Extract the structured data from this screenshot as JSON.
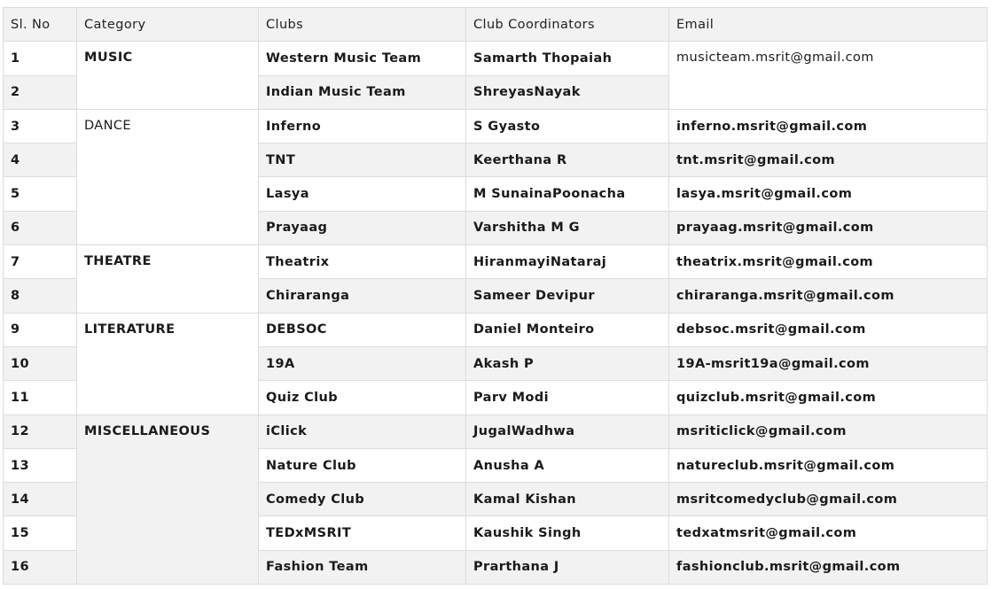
{
  "table": {
    "headers": {
      "sl_no": "Sl. No",
      "category": "Category",
      "clubs": "Clubs",
      "coordinators": "Club Coordinators",
      "email": "Email"
    },
    "categories": {
      "music": "MUSIC",
      "dance": "DANCE",
      "theatre": "THEATRE",
      "literature": "LITERATURE",
      "misc": "MISCELLANEOUS"
    },
    "rows": [
      {
        "no": "1",
        "club": "Western Music Team",
        "coordinator": "Samarth Thopaiah",
        "email": "musicteam.msrit@gmail.com"
      },
      {
        "no": "2",
        "club": "Indian Music Team",
        "coordinator": "ShreyasNayak",
        "email": ""
      },
      {
        "no": "3",
        "club": "Inferno",
        "coordinator": "S Gyasto",
        "email": "inferno.msrit@gmail.com"
      },
      {
        "no": "4",
        "club": "TNT",
        "coordinator": "Keerthana R",
        "email": "tnt.msrit@gmail.com"
      },
      {
        "no": "5",
        "club": "Lasya",
        "coordinator": "M SunainaPoonacha",
        "email": "lasya.msrit@gmail.com"
      },
      {
        "no": "6",
        "club": "Prayaag",
        "coordinator": "Varshitha M G",
        "email": "prayaag.msrit@gmail.com"
      },
      {
        "no": "7",
        "club": "Theatrix",
        "coordinator": "HiranmayiNataraj",
        "email": "theatrix.msrit@gmail.com"
      },
      {
        "no": "8",
        "club": "Chiraranga",
        "coordinator": "Sameer Devipur",
        "email": "chiraranga.msrit@gmail.com"
      },
      {
        "no": "9",
        "club": "DEBSOC",
        "coordinator": "Daniel Monteiro",
        "email": "debsoc.msrit@gmail.com"
      },
      {
        "no": "10",
        "club": "19A",
        "coordinator": "Akash P",
        "email": "19A-msrit19a@gmail.com"
      },
      {
        "no": "11",
        "club": "Quiz Club",
        "coordinator": "Parv Modi",
        "email": "quizclub.msrit@gmail.com"
      },
      {
        "no": "12",
        "club": "iClick",
        "coordinator": "JugalWadhwa",
        "email": "msriticlick@gmail.com"
      },
      {
        "no": "13",
        "club": "Nature Club",
        "coordinator": "Anusha A",
        "email": "natureclub.msrit@gmail.com"
      },
      {
        "no": "14",
        "club": "Comedy Club",
        "coordinator": "Kamal Kishan",
        "email": "msritcomedyclub@gmail.com"
      },
      {
        "no": "15",
        "club": "TEDxMSRIT",
        "coordinator": "Kaushik Singh",
        "email": "tedxatmsrit@gmail.com"
      },
      {
        "no": "16",
        "club": "Fashion Team",
        "coordinator": "Prarthana J",
        "email": "fashionclub.msrit@gmail.com"
      }
    ]
  }
}
